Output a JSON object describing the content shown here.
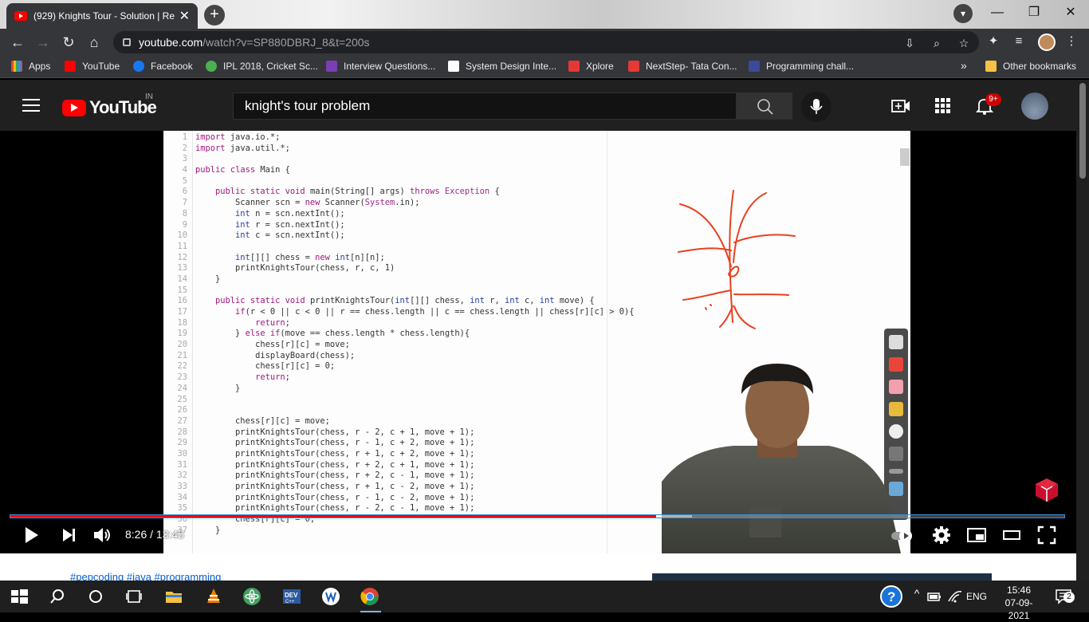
{
  "browser": {
    "tab_title": "(929) Knights Tour - Solution | Re",
    "tab_close": "✕",
    "new_tab": "+",
    "url_host": "youtube.com",
    "url_path": "/watch?v=SP880DBRJ_8&t=200s",
    "window_buttons": {
      "minimize": "—",
      "restore": "❐",
      "close": "✕"
    }
  },
  "bookmarks": [
    {
      "label": "Apps",
      "color": "#e8453c"
    },
    {
      "label": "YouTube",
      "color": "#ff0000"
    },
    {
      "label": "Facebook",
      "color": "#1877f2"
    },
    {
      "label": "IPL 2018, Cricket Sc...",
      "color": "#4caf50"
    },
    {
      "label": "Interview Questions...",
      "color": "#7b3fb5"
    },
    {
      "label": "System Design Inte...",
      "color": "#ffffff"
    },
    {
      "label": "Xplore",
      "color": "#e53935"
    },
    {
      "label": "NextStep- Tata Con...",
      "color": "#e53935"
    },
    {
      "label": "Programming chall...",
      "color": "#3b4a9a"
    }
  ],
  "bookmarks_more": "»",
  "other_bookmarks": "Other bookmarks",
  "youtube": {
    "logo_text": "YouTube",
    "country": "IN",
    "search_query": "knight's tour problem",
    "notification_badge": "9+"
  },
  "video": {
    "code_lines": [
      {
        "n": "1",
        "code": "import java.io.*;"
      },
      {
        "n": "2",
        "code": "import java.util.*;"
      },
      {
        "n": "3",
        "code": ""
      },
      {
        "n": "4",
        "code": "public class Main {"
      },
      {
        "n": "5",
        "code": ""
      },
      {
        "n": "6",
        "code": "    public static void main(String[] args) throws Exception {"
      },
      {
        "n": "7",
        "code": "        Scanner scn = new Scanner(System.in);"
      },
      {
        "n": "8",
        "code": "        int n = scn.nextInt();"
      },
      {
        "n": "9",
        "code": "        int r = scn.nextInt();"
      },
      {
        "n": "10",
        "code": "        int c = scn.nextInt();"
      },
      {
        "n": "11",
        "code": ""
      },
      {
        "n": "12",
        "code": "        int[][] chess = new int[n][n];"
      },
      {
        "n": "13",
        "code": "        printKnightsTour(chess, r, c, 1)"
      },
      {
        "n": "14",
        "code": "    }"
      },
      {
        "n": "15",
        "code": ""
      },
      {
        "n": "16",
        "code": "    public static void printKnightsTour(int[][] chess, int r, int c, int move) {"
      },
      {
        "n": "17",
        "code": "        if(r < 0 || c < 0 || r == chess.length || c == chess.length || chess[r][c] > 0){"
      },
      {
        "n": "18",
        "code": "            return;"
      },
      {
        "n": "19",
        "code": "        } else if(move == chess.length * chess.length){"
      },
      {
        "n": "20",
        "code": "            chess[r][c] = move;"
      },
      {
        "n": "21",
        "code": "            displayBoard(chess);"
      },
      {
        "n": "22",
        "code": "            chess[r][c] = 0;"
      },
      {
        "n": "23",
        "code": "            return;"
      },
      {
        "n": "24",
        "code": "        }"
      },
      {
        "n": "25",
        "code": ""
      },
      {
        "n": "26",
        "code": ""
      },
      {
        "n": "27",
        "code": "        chess[r][c] = move;"
      },
      {
        "n": "28",
        "code": "        printKnightsTour(chess, r - 2, c + 1, move + 1);"
      },
      {
        "n": "29",
        "code": "        printKnightsTour(chess, r - 1, c + 2, move + 1);"
      },
      {
        "n": "30",
        "code": "        printKnightsTour(chess, r + 1, c + 2, move + 1);"
      },
      {
        "n": "31",
        "code": "        printKnightsTour(chess, r + 2, c + 1, move + 1);"
      },
      {
        "n": "32",
        "code": "        printKnightsTour(chess, r + 2, c - 1, move + 1);"
      },
      {
        "n": "33",
        "code": "        printKnightsTour(chess, r + 1, c - 2, move + 1);"
      },
      {
        "n": "34",
        "code": "        printKnightsTour(chess, r - 1, c - 2, move + 1);"
      },
      {
        "n": "35",
        "code": "        printKnightsTour(chess, r - 2, c - 1, move + 1);"
      },
      {
        "n": "36",
        "code": "        chess[r][c] = 0;"
      },
      {
        "n": "37",
        "code": "    }"
      }
    ],
    "current_time": "8:26",
    "duration": "13:45",
    "played_fraction": 0.613,
    "buffered_fraction": 0.647
  },
  "below_video": {
    "hashtags": "#pepcoding #java #programming"
  },
  "taskbar": {
    "lang": "ENG",
    "time": "15:46",
    "date": "07-09-2021",
    "notification_count": "2"
  },
  "colors": {
    "youtube_red": "#ff0000",
    "chrome_dark": "#35363a",
    "yt_header": "#202020",
    "link_blue": "#065fd4"
  }
}
